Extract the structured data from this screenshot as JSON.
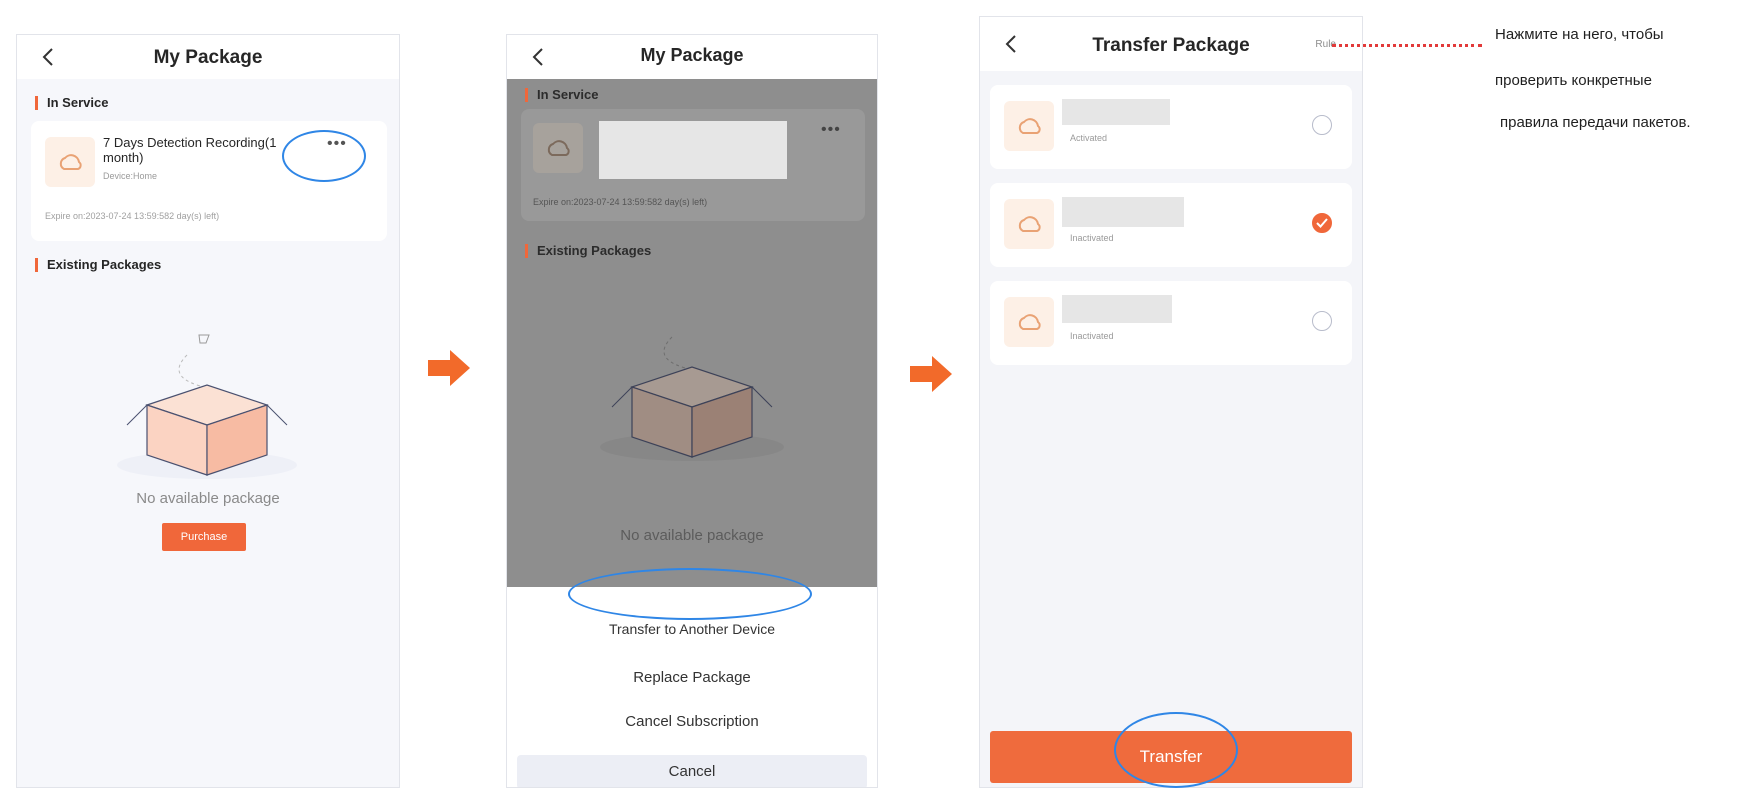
{
  "colors": {
    "accent": "#f0673a",
    "highlight": "#2f86e6",
    "annotation": "#e23a3a"
  },
  "screen1": {
    "title": "My Package",
    "in_service_label": "In Service",
    "package_name": "7 Days Detection Recording(1 month)",
    "device_label": "Device:Home",
    "expire_label": "Expire on:2023-07-24 13:59:582 day(s) left)",
    "existing_label": "Existing Packages",
    "empty_text": "No available package",
    "purchase_label": "Purchase"
  },
  "screen2": {
    "title": "My Package",
    "in_service_label": "In Service",
    "expire_label": "Expire on:2023-07-24 13:59:582 day(s) left)",
    "existing_label": "Existing Packages",
    "empty_text": "No available package",
    "menu": {
      "transfer": "Transfer to Another Device",
      "replace": "Replace Package",
      "cancel_subscription": "Cancel Subscription",
      "cancel": "Cancel"
    }
  },
  "screen3": {
    "title": "Transfer Package",
    "rule_label": "Rule",
    "items": [
      {
        "status": "Activated",
        "selected": false
      },
      {
        "status": "Inactivated",
        "selected": true
      },
      {
        "status": "Inactivated",
        "selected": false
      }
    ],
    "transfer_label": "Transfer"
  },
  "annotation": {
    "line1": "Нажмите на него, чтобы",
    "line2": "проверить конкретные",
    "line3": "правила передачи пакетов."
  },
  "icons": [
    "back-icon",
    "cloud-package-icon",
    "more-icon",
    "next-arrow-icon",
    "checkmark-icon",
    "empty-box-illustration"
  ]
}
